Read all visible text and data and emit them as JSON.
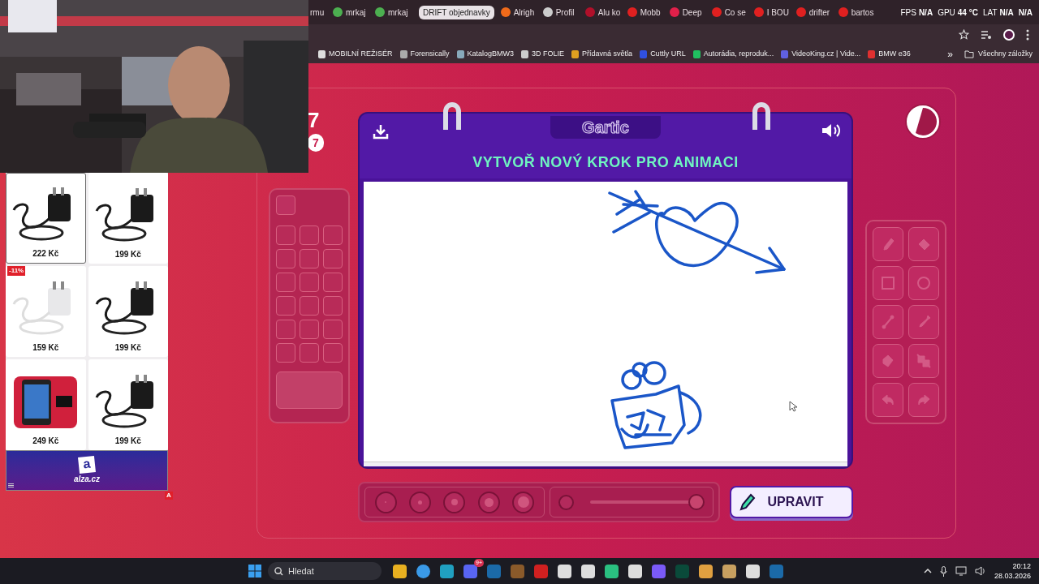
{
  "browser": {
    "tabs": [
      {
        "kind": "tab",
        "label": "rmu"
      },
      {
        "kind": "tab",
        "label": "mrkaj"
      },
      {
        "kind": "tab",
        "label": "mrkaj"
      },
      {
        "kind": "group",
        "label": "DRIFT objednavky"
      },
      {
        "kind": "tab",
        "label": "Alrigh"
      },
      {
        "kind": "tab",
        "label": "Profil"
      },
      {
        "kind": "tab",
        "label": "Alu ko"
      },
      {
        "kind": "tab",
        "label": "Mobb"
      },
      {
        "kind": "tab",
        "label": "Deep"
      },
      {
        "kind": "tab",
        "label": "Co se"
      },
      {
        "kind": "tab",
        "label": "I BOU"
      },
      {
        "kind": "tab",
        "label": "drifter"
      },
      {
        "kind": "tab",
        "label": "bartos"
      }
    ],
    "bookmarks": [
      "MOBILNÍ REŽISÉR",
      "Forensically",
      "KatalogBMW3",
      "3D FOLIE",
      "Přídavná světla",
      "Cuttly URL",
      "Autorádia, reproduk...",
      "VideoKing.cz | Vide...",
      "BMW e36"
    ],
    "more_bookmarks": "»",
    "all_bookmarks": "Všechny záložky"
  },
  "perf_overlay": [
    {
      "label": "FPS",
      "value": "N/A"
    },
    {
      "label": "GPU",
      "value": "44 °C"
    },
    {
      "label": "LAT",
      "value": "N/A"
    },
    {
      "value": "N/A"
    }
  ],
  "game": {
    "round_digits": [
      "7",
      "7"
    ],
    "logo": "Gartic",
    "title": "VYTVOŘ NOVÝ KROK PRO ANIMACI",
    "tools": [
      {
        "selected": false
      },
      {
        "selected": false
      },
      {
        "selected": false
      },
      {
        "selected": false
      },
      {
        "selected": false
      },
      {
        "selected": false
      },
      {
        "selected": false
      },
      {
        "selected": false
      },
      {
        "selected": false
      },
      {
        "selected": false
      }
    ],
    "brush_sizes": [
      {
        "selected": false
      },
      {
        "selected": false
      },
      {
        "selected": false
      },
      {
        "selected": false
      },
      {
        "selected": false
      }
    ],
    "opacity": {
      "level": 1
    },
    "edit_button": "UPRAVIT"
  },
  "ad": {
    "products": [
      {
        "price": "222 Kč"
      },
      {
        "price": "199 Kč"
      },
      {
        "price": "159 Kč",
        "discount": "-11%"
      },
      {
        "price": "199 Kč"
      },
      {
        "price": "249 Kč"
      },
      {
        "price": "199 Kč"
      }
    ],
    "brand": "alza.cz",
    "logo_letter": "a",
    "corner_badge": "A"
  },
  "taskbar": {
    "search": "Hledat",
    "badge": "9+",
    "time": "20:12",
    "date": "28.03.2026"
  }
}
